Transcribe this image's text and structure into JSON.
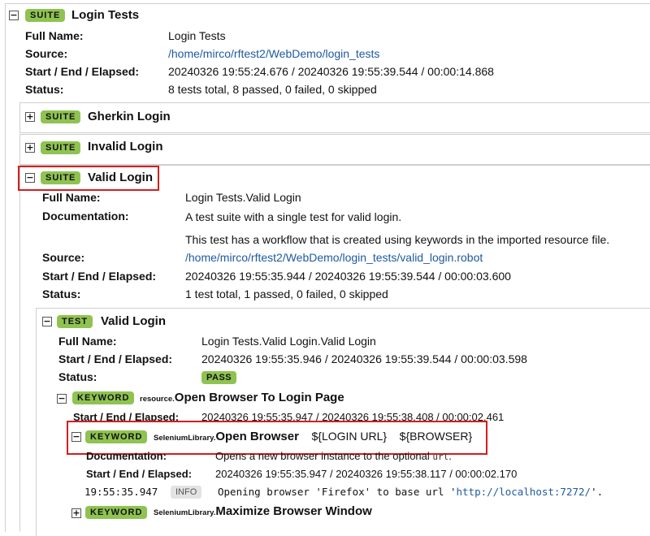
{
  "colors": {
    "badge": "#8fc351",
    "link": "#1e5aa0",
    "highlight": "#d21f1f"
  },
  "root": {
    "badge": "SUITE",
    "name": "Login Tests",
    "full_name_label": "Full Name:",
    "full_name": "Login Tests",
    "source_label": "Source:",
    "source": "/home/mirco/rftest2/WebDemo/login_tests",
    "times_label": "Start / End / Elapsed:",
    "times": "20240326 19:55:24.676 / 20240326 19:55:39.544 / 00:00:14.868",
    "status_label": "Status:",
    "status": "8 tests total, 8 passed, 0 failed, 0 skipped"
  },
  "suites": [
    {
      "badge": "SUITE",
      "name": "Gherkin Login",
      "toggle": "+"
    },
    {
      "badge": "SUITE",
      "name": "Invalid Login",
      "toggle": "+"
    }
  ],
  "valid_suite": {
    "toggle": "−",
    "badge": "SUITE",
    "name": "Valid Login",
    "full_name_label": "Full Name:",
    "full_name": "Login Tests.Valid Login",
    "doc_label": "Documentation:",
    "doc_line1": "A test suite with a single test for valid login.",
    "doc_line2": "This test has a workflow that is created using keywords in the imported resource file.",
    "source_label": "Source:",
    "source": "/home/mirco/rftest2/WebDemo/login_tests/valid_login.robot",
    "times_label": "Start / End / Elapsed:",
    "times": "20240326 19:55:35.944 / 20240326 19:55:39.544 / 00:00:03.600",
    "status_label": "Status:",
    "status": "1 test total, 1 passed, 0 failed, 0 skipped"
  },
  "test": {
    "toggle": "−",
    "badge": "TEST",
    "name": "Valid Login",
    "full_name_label": "Full Name:",
    "full_name": "Login Tests.Valid Login.Valid Login",
    "times_label": "Start / End / Elapsed:",
    "times": "20240326 19:55:35.946 / 20240326 19:55:39.544 / 00:00:03.598",
    "status_label": "Status:",
    "status": "PASS"
  },
  "kw_open_login": {
    "toggle": "−",
    "badge": "KEYWORD",
    "lib": "resource",
    "name": "Open Browser To Login Page",
    "times_label": "Start / End / Elapsed:",
    "times": "20240326 19:55:35.947 / 20240326 19:55:38.408 / 00:00:02.461"
  },
  "kw_open_browser": {
    "toggle": "−",
    "badge": "KEYWORD",
    "lib": "SeleniumLibrary",
    "name": "Open Browser",
    "arg1": "${LOGIN URL}",
    "arg2": "${BROWSER}",
    "doc_label": "Documentation:",
    "doc_pre": "Opens a new browser instance to the optional",
    "doc_code": "url",
    "doc_post": ".",
    "times_label": "Start / End / Elapsed:",
    "times": "20240326 19:55:35.947 / 20240326 19:55:38.117 / 00:00:02.170",
    "log_time": "19:55:35.947",
    "log_level": "INFO",
    "log_pre": "Opening browser 'Firefox' to base url '",
    "log_url": "http://localhost:7272/",
    "log_post": "'."
  },
  "kw_maximize": {
    "toggle": "+",
    "badge": "KEYWORD",
    "lib": "SeleniumLibrary",
    "name": "Maximize Browser Window"
  }
}
